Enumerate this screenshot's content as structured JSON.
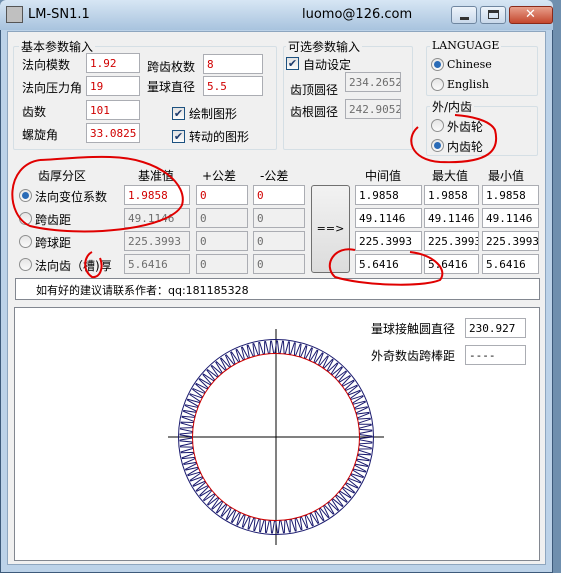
{
  "window": {
    "title": "LM-SN1.1",
    "author_email": "luomo@126.com"
  },
  "basic": {
    "group_label": "基本参数输入",
    "normal_module": {
      "label": "法向模数",
      "value": "1.92"
    },
    "pressure_angle": {
      "label": "法向压力角",
      "value": "19"
    },
    "teeth": {
      "label": "齿数",
      "value": "101"
    },
    "helix_angle": {
      "label": "螺旋角",
      "value": "33.0825"
    },
    "span_teeth": {
      "label": "跨齿枚数",
      "value": "8"
    },
    "ball_diameter": {
      "label": "量球直径",
      "value": "5.5"
    },
    "draw_checkbox": {
      "label": "绘制图形",
      "checked": true
    },
    "rotate_checkbox": {
      "label": "转动的图形",
      "checked": true
    }
  },
  "optional": {
    "group_label": "可选参数输入",
    "auto_checkbox": {
      "label": "自动设定",
      "checked": true
    },
    "tip_diameter": {
      "label": "齿顶圆径",
      "value": "234.2652"
    },
    "root_diameter": {
      "label": "齿根圆径",
      "value": "242.9052"
    }
  },
  "language": {
    "group_label": "LANGUAGE",
    "options": [
      "Chinese",
      "English"
    ],
    "selected": "Chinese"
  },
  "gear_type": {
    "group_label": "外/内齿",
    "options": [
      "外齿轮",
      "内齿轮"
    ],
    "selected": "内齿轮"
  },
  "table": {
    "headers": {
      "section": "齿厚分区",
      "base": "基准值",
      "plus": "+公差",
      "minus": "-公差",
      "mid": "中间值",
      "max": "最大值",
      "min": "最小值"
    },
    "rows": [
      {
        "label": "法向变位系数",
        "base": "1.9858",
        "plus": "0",
        "minus": "0",
        "mid": "1.9858",
        "max": "1.9858",
        "min": "1.9858"
      },
      {
        "label": "跨齿距",
        "base": "49.1146",
        "plus": "0",
        "minus": "0",
        "mid": "49.1146",
        "max": "49.1146",
        "min": "49.1146"
      },
      {
        "label": "跨球距",
        "base": "225.3993",
        "plus": "0",
        "minus": "0",
        "mid": "225.3993",
        "max": "225.3993",
        "min": "225.3993"
      },
      {
        "label": "法向齿（槽)厚",
        "base": "5.6416",
        "plus": "0",
        "minus": "0",
        "mid": "5.6416",
        "max": "5.6416",
        "min": "5.6416"
      }
    ],
    "selected_row": 0,
    "compute_button": "==>"
  },
  "status_text": "如有好的建议请联系作者：qq:181185328",
  "drawing": {
    "ball_contact_label": "量球接触圆直径",
    "ball_contact_value": "230.927",
    "odd_tooth_label": "外奇数齿跨棒距",
    "odd_tooth_value": "----",
    "gear_teeth": 101
  },
  "colors": {
    "accent_red": "#d00000",
    "tooth_blue": "#1a1a6e",
    "root_red": "#cc0000"
  }
}
